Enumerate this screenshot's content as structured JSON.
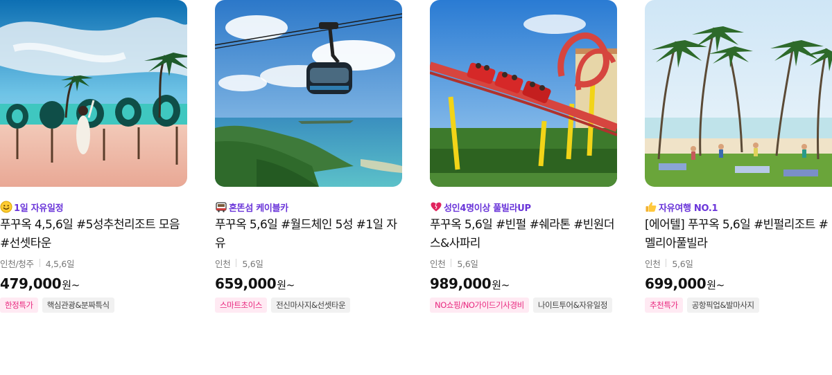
{
  "products": [
    {
      "tag_icon": "smiley-face-icon",
      "tag": "1일 자유일정",
      "title": "푸꾸옥 4,5,6일 #5성추천리조트 모음 #선셋타운",
      "departure": "인천/청주",
      "duration": "4,5,6일",
      "price": "479,000",
      "price_unit": "원~",
      "chips": [
        {
          "label": "한정특가",
          "style": "pink"
        },
        {
          "label": "핵심관광&분짜특식",
          "style": "gray"
        }
      ]
    },
    {
      "tag_icon": "train-icon",
      "tag": "혼똔섬 케이블카",
      "title": "푸꾸옥 5,6일 #월드체인 5성 #1일 자유",
      "departure": "인천",
      "duration": "5,6일",
      "price": "659,000",
      "price_unit": "원~",
      "chips": [
        {
          "label": "스마트초이스",
          "style": "pink"
        },
        {
          "label": "전신마사지&선셋타운",
          "style": "gray"
        }
      ]
    },
    {
      "tag_icon": "heart-icon",
      "tag": "성인4명이상 풀빌라UP",
      "title": "푸꾸옥 5,6일 #빈펄 #쉐라톤 #빈원더스&사파리",
      "departure": "인천",
      "duration": "5,6일",
      "price": "989,000",
      "price_unit": "원~",
      "chips": [
        {
          "label": "NO쇼핑/NO가이드기사경비",
          "style": "pink"
        },
        {
          "label": "나이트투어&자유일정",
          "style": "gray"
        }
      ]
    },
    {
      "tag_icon": "thumbs-up-icon",
      "tag": "자유여행 NO.1",
      "title": "[에어텔] 푸꾸옥 5,6일 #빈펄리조트 #멜리아풀빌라",
      "departure": "인천",
      "duration": "5,6일",
      "price": "699,000",
      "price_unit": "원~",
      "chips": [
        {
          "label": "추천특가",
          "style": "pink"
        },
        {
          "label": "공항픽업&발마사지",
          "style": "gray"
        }
      ]
    }
  ],
  "colors": {
    "tag_purple": "#6a35d9",
    "chip_pink_bg": "#ffeaf3",
    "chip_pink_text": "#e8277e",
    "chip_gray_bg": "#f1f1f1"
  }
}
